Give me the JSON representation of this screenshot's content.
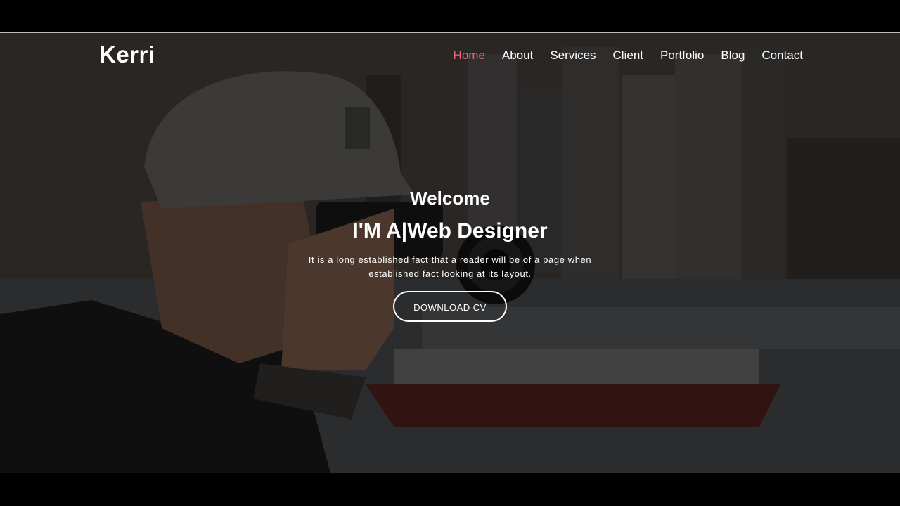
{
  "brand": {
    "logo_text": "Kerri"
  },
  "nav": {
    "items": [
      {
        "label": "Home",
        "active": true
      },
      {
        "label": "About",
        "active": false
      },
      {
        "label": "Services",
        "active": false
      },
      {
        "label": "Client",
        "active": false
      },
      {
        "label": "Portfolio",
        "active": false
      },
      {
        "label": "Blog",
        "active": false
      },
      {
        "label": "Contact",
        "active": false
      }
    ]
  },
  "hero": {
    "welcome": "Welcome",
    "headline": "I'M A|Web Designer",
    "description": "It is a long established fact that a reader will be of a page when established fact looking at its layout.",
    "button_label": "DOWNLOAD CV"
  },
  "colors": {
    "accent": "#e8677f",
    "text": "#ffffff",
    "overlay": "rgba(0,0,0,0.45)"
  }
}
